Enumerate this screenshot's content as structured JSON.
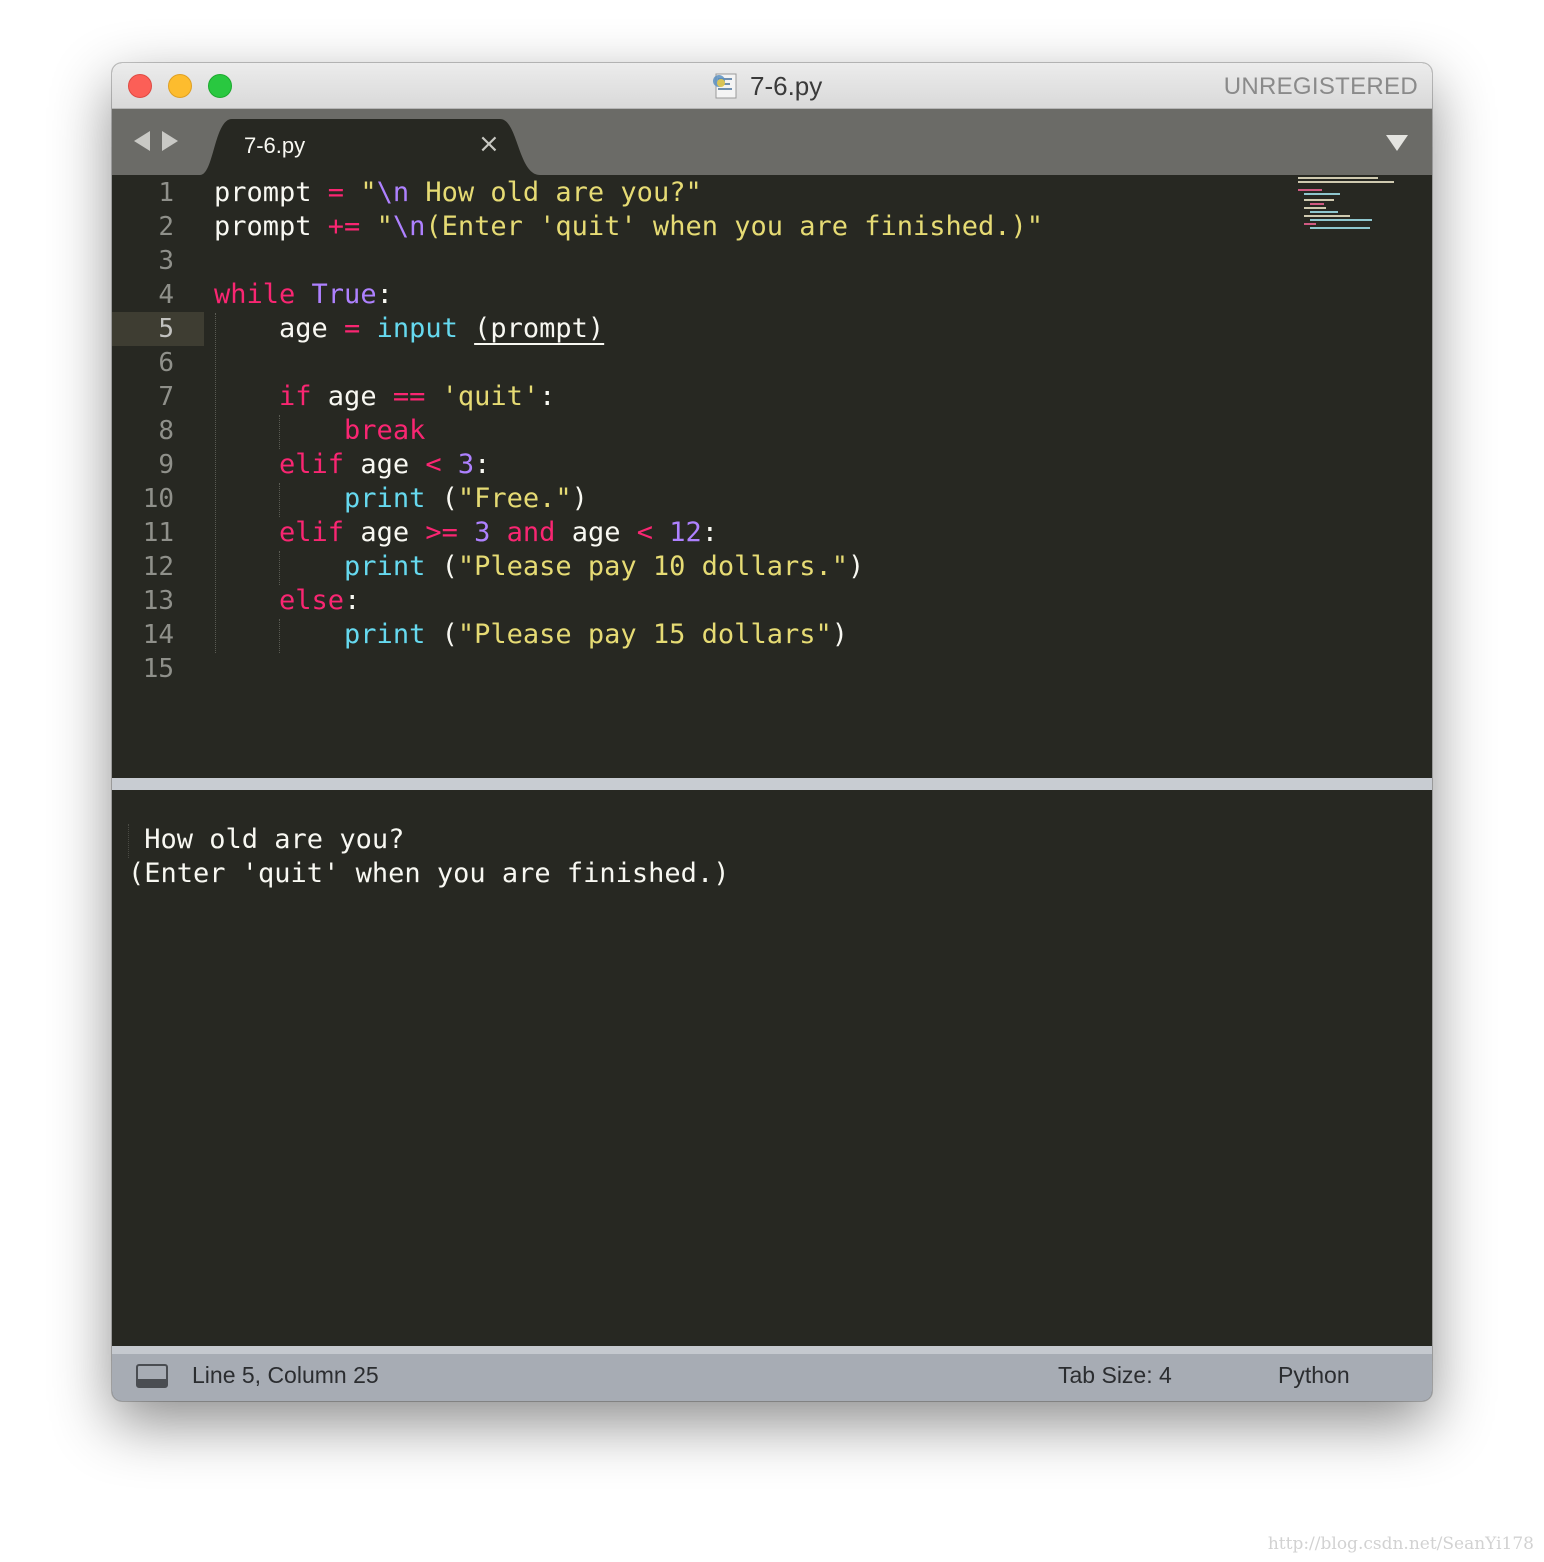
{
  "window": {
    "title": "7-6.py",
    "registration": "UNREGISTERED"
  },
  "tabs": [
    {
      "label": "7-6.py",
      "close": "×"
    }
  ],
  "editor": {
    "active_line": 5,
    "line_numbers": [
      "1",
      "2",
      "3",
      "4",
      "5",
      "6",
      "7",
      "8",
      "9",
      "10",
      "11",
      "12",
      "13",
      "14",
      "15"
    ],
    "lines": [
      "prompt = \"\\n How old are you?\"",
      "prompt += \"\\n(Enter 'quit' when you are finished.)\"",
      "",
      "while True:",
      "    age = input (prompt)",
      "",
      "    if age == 'quit':",
      "        break",
      "    elif age < 3:",
      "        print (\"Free.\")",
      "    elif age >= 3 and age < 12:",
      "        print (\"Please pay 10 dollars.\")",
      "    else:",
      "        print (\"Please pay 15 dollars\")",
      ""
    ]
  },
  "console": {
    "lines": [
      " How old are you?",
      "(Enter 'quit' when you are finished.)"
    ]
  },
  "status": {
    "position": "Line 5, Column 25",
    "tab_size": "Tab Size: 4",
    "syntax": "Python"
  },
  "watermark": "http://blog.csdn.net/SeanYi178",
  "colors": {
    "background": "#272822",
    "keyword": "#f92672",
    "string": "#e6db74",
    "number": "#ae81ff",
    "builtin": "#66d9ef"
  }
}
